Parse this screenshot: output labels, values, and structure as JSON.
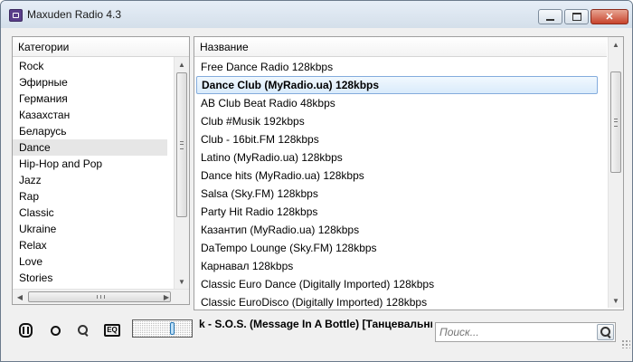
{
  "window": {
    "title": "Maxuden Radio 4.3"
  },
  "categories": {
    "header": "Категории",
    "items": [
      "Rock",
      "Эфирные",
      "Германия",
      "Казахстан",
      "Беларусь",
      "Dance",
      "Hip-Hop and Pop",
      "Jazz",
      "Rap",
      "Classic",
      "Ukraine",
      "Relax",
      "Love",
      "Stories"
    ],
    "selected": "Dance"
  },
  "stations": {
    "header": "Название",
    "items": [
      "Free Dance Radio 128kbps",
      "Dance Club (MyRadio.ua)  128kbps",
      "AB Club Beat Radio 48kbps",
      "Club #Musik 192kbps",
      "Club - 16bit.FM 128kbps",
      "Latino (MyRadio.ua) 128kbps",
      "Dance hits (MyRadio.ua) 128kbps",
      "Salsa (Sky.FM) 128kbps",
      "Party Hit Radio 128kbps",
      "Казантип (MyRadio.ua) 128kbps",
      "DaTempo Lounge (Sky.FM) 128kbps",
      "Карнавал 128kbps",
      "Classic Euro Dance (Digitally Imported) 128kbps",
      "Classic EuroDisco (Digitally Imported) 128kbps"
    ],
    "selected": "Dance Club (MyRadio.ua)  128kbps"
  },
  "player": {
    "now_playing": "k - S.O.S. (Message In A Bottle) [Танцевальный",
    "volume_level": 0.7,
    "icons": [
      "pause-icon",
      "record-icon",
      "search-station-icon",
      "equalizer-icon"
    ],
    "eq_label": "EQ"
  },
  "search": {
    "placeholder": "Поиск..."
  },
  "colors": {
    "selection_border": "#84acdd",
    "selection_fill": "#d9ebfb",
    "close_button": "#c7432c"
  }
}
